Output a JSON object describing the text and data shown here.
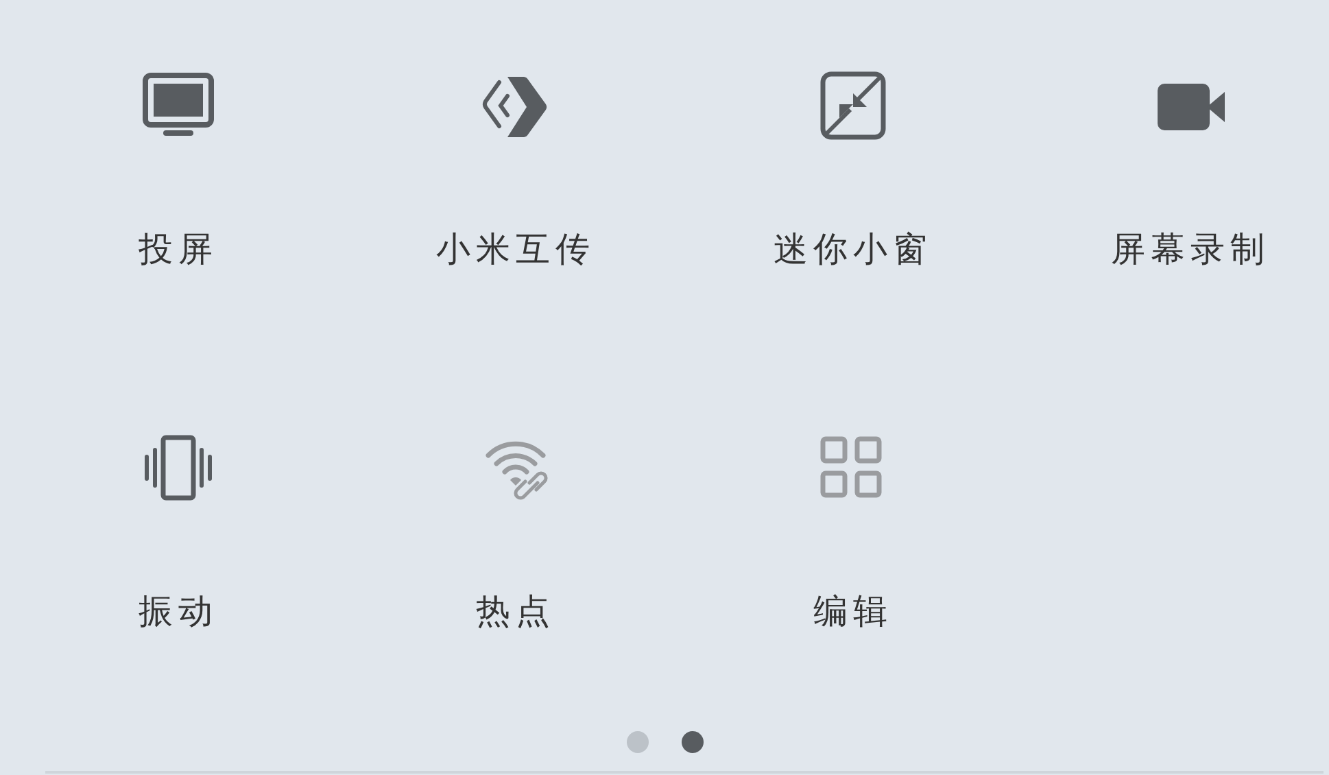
{
  "tiles": [
    {
      "kind": "cast",
      "label": "投屏",
      "on": true
    },
    {
      "kind": "transfer",
      "label": "小米互传",
      "on": true
    },
    {
      "kind": "mini-window",
      "label": "迷你小窗",
      "on": true
    },
    {
      "kind": "screen-record",
      "label": "屏幕录制",
      "on": true
    },
    {
      "kind": "vibrate",
      "label": "振动",
      "on": true
    },
    {
      "kind": "hotspot",
      "label": "热点",
      "on": false
    },
    {
      "kind": "edit",
      "label": "编辑",
      "on": false
    }
  ],
  "pages": [
    {
      "selected": false
    },
    {
      "selected": true
    }
  ]
}
